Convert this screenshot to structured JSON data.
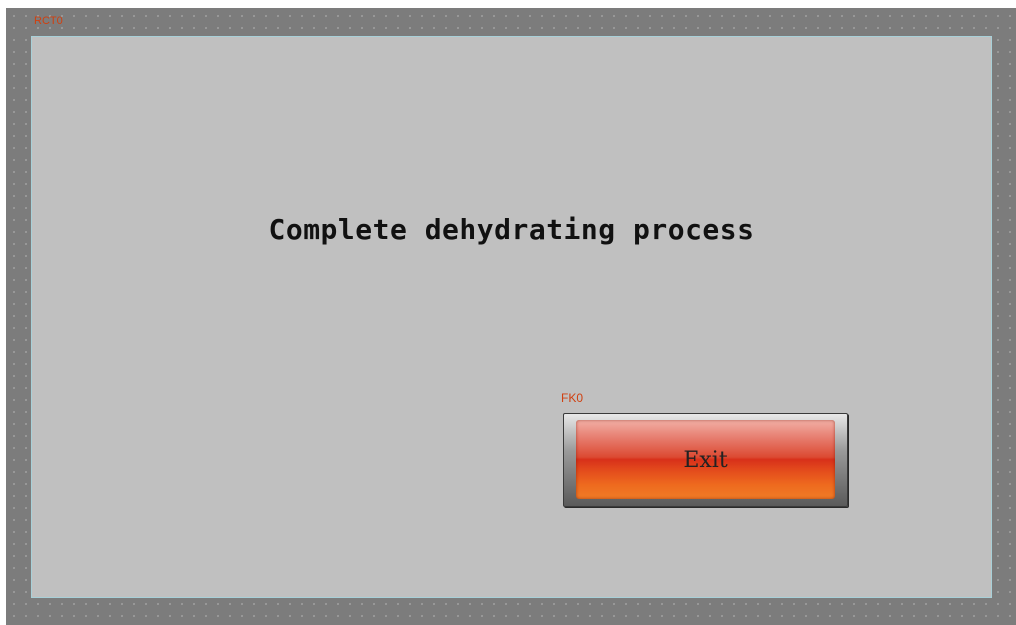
{
  "screen": {
    "rect_label": "RCT0",
    "message": "Complete dehydrating process",
    "exit_button": {
      "id_label": "FK0",
      "label": "Exit"
    }
  },
  "colors": {
    "canvas_background": "#7c7c7c",
    "panel_background": "#c0c0c0",
    "panel_border": "#a8d0d8",
    "id_label_color": "#d04010",
    "button_red": "#d8301a",
    "button_orange": "#f07c26"
  }
}
